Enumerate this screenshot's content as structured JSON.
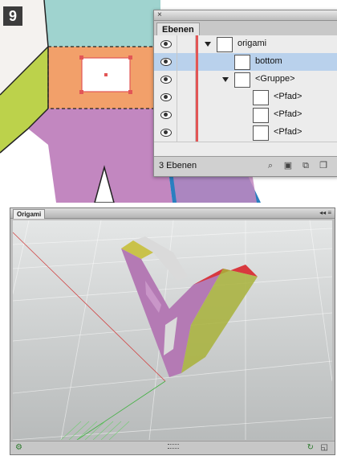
{
  "step_number": "9",
  "layers_panel": {
    "close_glyph": "×",
    "tab_label": "Ebenen",
    "rows": [
      {
        "label": "origami",
        "level": 0,
        "expanded": true,
        "selected": false
      },
      {
        "label": "bottom",
        "level": 1,
        "expanded": false,
        "selected": true
      },
      {
        "label": "<Gruppe>",
        "level": 1,
        "expanded": true,
        "selected": false
      },
      {
        "label": "<Pfad>",
        "level": 2,
        "expanded": false,
        "selected": false
      },
      {
        "label": "<Pfad>",
        "level": 2,
        "expanded": false,
        "selected": false
      },
      {
        "label": "<Pfad>",
        "level": 2,
        "expanded": false,
        "selected": false
      }
    ],
    "footer_text": "3 Ebenen",
    "layer_color": "#e25656",
    "selection_color": "#b9d1ec"
  },
  "viewer_window": {
    "tab_label": "Origami",
    "controls": "◂◂ ≡",
    "status_left_icon": "gear-icon",
    "status_right_icons": [
      "refresh-icon",
      "frame-icon"
    ],
    "model_colors": {
      "face": "#b47ab4",
      "top": "#c9c24a",
      "red": "#d8393e",
      "side": "#a8b23a",
      "inner": "#dadada"
    }
  },
  "artwork_colors": {
    "teal": "#9fd3cf",
    "orange": "#f2a06a",
    "lime": "#bcd24b",
    "purple": "#c287c0",
    "blue": "#2a7fc0"
  }
}
